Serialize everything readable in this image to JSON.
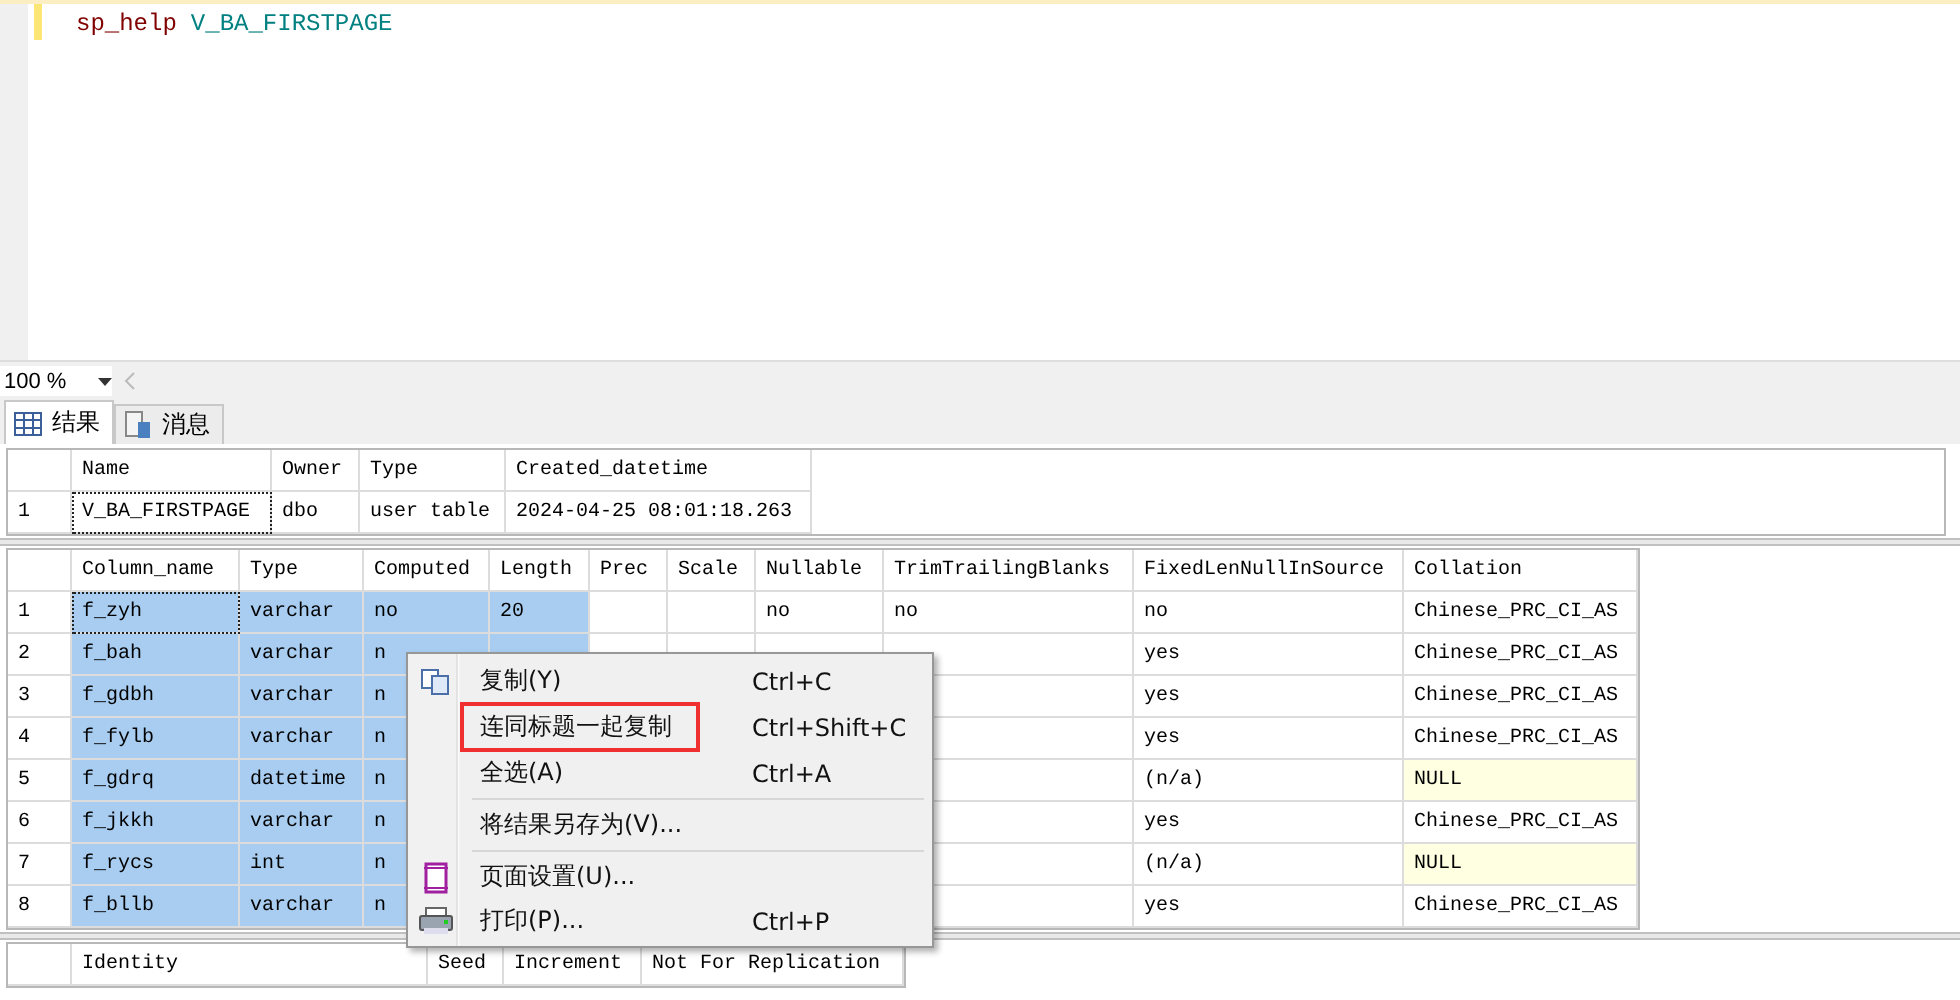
{
  "editor": {
    "lines": [
      {
        "tokens": [
          {
            "text": "sp_help",
            "kind": "keyword"
          },
          {
            "text": "V_BA_FIRSTPAGE",
            "kind": "identifier"
          }
        ]
      }
    ]
  },
  "zoom": {
    "value": "100 %"
  },
  "tabs": [
    {
      "label": "结果",
      "kind": "grid",
      "selected": true
    },
    {
      "label": "消息",
      "kind": "messages",
      "selected": false
    }
  ],
  "grids": [
    {
      "columns": [
        "Name",
        "Owner",
        "Type",
        "Created_datetime"
      ],
      "rows": [
        {
          "number": "1",
          "cells": [
            {
              "text": "V_BA_FIRSTPAGE",
              "focused": true,
              "selected": false
            },
            {
              "text": "dbo",
              "selected": false
            },
            {
              "text": "user table",
              "selected": false
            },
            {
              "text": "2024-04-25 08:01:18.263",
              "selected": false
            }
          ]
        }
      ]
    },
    {
      "columns": [
        "Column_name",
        "Type",
        "Computed",
        "Length",
        "Prec",
        "Scale",
        "Nullable",
        "TrimTrailingBlanks",
        "FixedLenNullInSource",
        "Collation"
      ],
      "rows": [
        {
          "number": "1",
          "cells": [
            {
              "text": "f_zyh",
              "focused": true,
              "selected": true
            },
            {
              "text": "varchar",
              "selected": true
            },
            {
              "text": "no",
              "selected": true
            },
            {
              "text": "20",
              "selected": true
            },
            {
              "selected": false
            },
            {
              "selected": false
            },
            {
              "text": "no",
              "selected": false
            },
            {
              "text": "no",
              "selected": false
            },
            {
              "text": "no",
              "selected": false
            },
            {
              "text": "Chinese_PRC_CI_AS",
              "selected": false
            }
          ]
        },
        {
          "number": "2",
          "cells": [
            {
              "text": "f_bah",
              "selected": true
            },
            {
              "text": "varchar",
              "selected": true
            },
            {
              "text": "n",
              "selected": true
            },
            {
              "selected": true
            },
            {
              "selected": false
            },
            {
              "selected": false
            },
            {
              "selected": false
            },
            {
              "selected": false
            },
            {
              "text": "yes",
              "selected": false
            },
            {
              "text": "Chinese_PRC_CI_AS",
              "selected": false
            }
          ]
        },
        {
          "number": "3",
          "cells": [
            {
              "text": "f_gdbh",
              "selected": true
            },
            {
              "text": "varchar",
              "selected": true
            },
            {
              "text": "n",
              "selected": true
            },
            null,
            null,
            null,
            null,
            {
              "selected": false
            },
            {
              "text": "yes",
              "selected": false
            },
            {
              "text": "Chinese_PRC_CI_AS",
              "selected": false
            }
          ]
        },
        {
          "number": "4",
          "cells": [
            {
              "text": "f_fylb",
              "selected": true
            },
            {
              "text": "varchar",
              "selected": true
            },
            {
              "text": "n",
              "selected": true
            },
            null,
            null,
            null,
            null,
            {
              "selected": false
            },
            {
              "text": "yes",
              "selected": false
            },
            {
              "text": "Chinese_PRC_CI_AS",
              "selected": false
            }
          ]
        },
        {
          "number": "5",
          "cells": [
            {
              "text": "f_gdrq",
              "selected": true
            },
            {
              "text": "datetime",
              "selected": true
            },
            {
              "text": "n",
              "selected": true
            },
            null,
            null,
            null,
            null,
            {
              "selected": false
            },
            {
              "text": "(n/a)",
              "selected": false
            },
            {
              "text": "NULL",
              "kind": "null",
              "selected": false
            }
          ]
        },
        {
          "number": "6",
          "cells": [
            {
              "text": "f_jkkh",
              "selected": true
            },
            {
              "text": "varchar",
              "selected": true
            },
            {
              "text": "n",
              "selected": true
            },
            null,
            null,
            null,
            null,
            {
              "selected": false
            },
            {
              "text": "yes",
              "selected": false
            },
            {
              "text": "Chinese_PRC_CI_AS",
              "selected": false
            }
          ]
        },
        {
          "number": "7",
          "cells": [
            {
              "text": "f_rycs",
              "selected": true
            },
            {
              "text": "int",
              "selected": true
            },
            {
              "text": "n",
              "selected": true
            },
            null,
            null,
            null,
            null,
            {
              "selected": false
            },
            {
              "text": "(n/a)",
              "selected": false
            },
            {
              "text": "NULL",
              "kind": "null",
              "selected": false
            }
          ]
        },
        {
          "number": "8",
          "cells": [
            {
              "text": "f_bllb",
              "selected": true
            },
            {
              "text": "varchar",
              "selected": true
            },
            {
              "text": "n",
              "selected": true
            },
            null,
            null,
            null,
            null,
            {
              "selected": false
            },
            {
              "text": "yes",
              "selected": false
            },
            {
              "text": "Chinese_PRC_CI_AS",
              "selected": false
            }
          ]
        }
      ]
    },
    {
      "columns": [
        "Identity",
        "Seed",
        "Increment",
        "Not For Replication"
      ]
    }
  ],
  "context_menu": {
    "items": [
      {
        "kind": "copy",
        "label": "复制(Y)",
        "shortcut": "Ctrl+C",
        "highlighted": false
      },
      {
        "kind": "plain",
        "label": "连同标题一起复制",
        "shortcut": "Ctrl+Shift+C",
        "highlighted": true
      },
      {
        "kind": "plain",
        "label": "全选(A)",
        "shortcut": "Ctrl+A",
        "highlighted": false
      },
      {
        "kind": "separator"
      },
      {
        "kind": "plain",
        "label": "将结果另存为(V)...",
        "highlighted": false
      },
      {
        "kind": "separator"
      },
      {
        "kind": "page",
        "label": "页面设置(U)...",
        "highlighted": false
      },
      {
        "kind": "print",
        "label": "打印(P)...",
        "shortcut": "Ctrl+P",
        "highlighted": false
      }
    ]
  }
}
